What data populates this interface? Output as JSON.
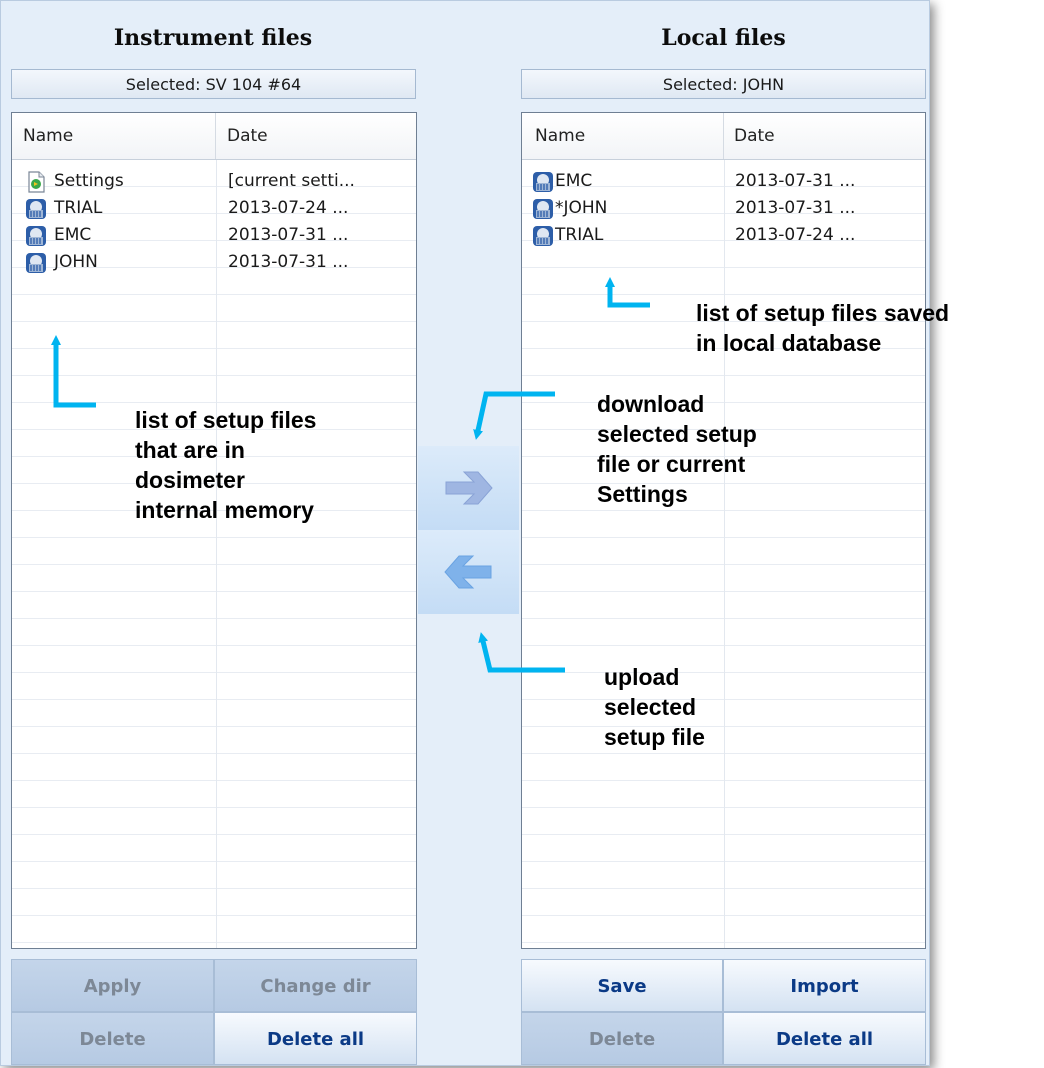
{
  "instrument": {
    "title": "Instrument files",
    "selected": "Selected: SV 104 #64",
    "col_name": "Name",
    "col_date": "Date",
    "rows": [
      {
        "name": "Settings",
        "date": "[current setti...",
        "icon": "settings-file-icon"
      },
      {
        "name": "TRIAL",
        "date": "2013-07-24 ...",
        "icon": "setup-file-icon"
      },
      {
        "name": "EMC",
        "date": "2013-07-31 ...",
        "icon": "setup-file-icon"
      },
      {
        "name": "JOHN",
        "date": "2013-07-31 ...",
        "icon": "setup-file-icon"
      }
    ],
    "buttons": {
      "apply": "Apply",
      "change_dir": "Change dir",
      "delete": "Delete",
      "delete_all": "Delete all"
    }
  },
  "local": {
    "title": "Local files",
    "selected": "Selected: JOHN",
    "col_name": "Name",
    "col_date": "Date",
    "rows": [
      {
        "name": "EMC",
        "date": "2013-07-31 ...",
        "icon": "setup-file-icon"
      },
      {
        "name": "*JOHN",
        "date": "2013-07-31 ...",
        "icon": "setup-file-icon"
      },
      {
        "name": "TRIAL",
        "date": "2013-07-24 ...",
        "icon": "setup-file-icon"
      }
    ],
    "buttons": {
      "save": "Save",
      "import": "Import",
      "delete": "Delete",
      "delete_all": "Delete all"
    }
  },
  "transfer": {
    "download_icon": "arrow-right-icon",
    "upload_icon": "arrow-left-icon"
  },
  "annotations": {
    "instrument_list_l1": "list of setup files",
    "instrument_list_l2": "that are in",
    "instrument_list_l3": "dosimeter",
    "instrument_list_l4": "internal  memory",
    "local_list_l1": "list of setup files saved",
    "local_list_l2": "in local database",
    "download_l1": "download",
    "download_l2": "selected setup",
    "download_l3": "file or current",
    "download_l4": "Settings",
    "upload_l1": "upload",
    "upload_l2": "selected",
    "upload_l3": "setup file"
  },
  "colors": {
    "annotation_arrow": "#00b4f0",
    "button_text": "#0b3a86",
    "disabled_text": "#7d8896"
  }
}
